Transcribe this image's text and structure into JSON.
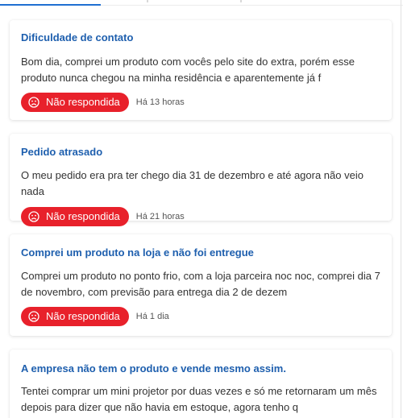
{
  "colors": {
    "title": "#1e5fae",
    "body_text": "#333333",
    "status_badge": "#e8212b",
    "tab_active": "#1f6fd1"
  },
  "complaints": [
    {
      "title": "Dificuldade de contato",
      "body": "Bom dia, comprei um produto com vocês pelo site do extra, porém esse produto nunca chegou na minha residência e aparentemente já f",
      "status": "Não respondida",
      "status_icon": "sad-face-icon",
      "time": "Há 13 horas"
    },
    {
      "title": "Pedido atrasado",
      "body": "O meu pedido era pra ter chego dia 31 de dezembro e até agora não veio nada",
      "status": "Não respondida",
      "status_icon": "sad-face-icon",
      "time": "Há 21 horas"
    },
    {
      "title": "Comprei um produto na loja e não foi entregue",
      "body": "Comprei um produto no ponto frio, com a loja parceira noc noc, comprei dia 7 de novembro, com previsão para entrega dia 2 de dezem",
      "status": "Não respondida",
      "status_icon": "sad-face-icon",
      "time": "Há 1 dia"
    },
    {
      "title": "A empresa não tem o produto e vende mesmo assim.",
      "body": "Tentei comprar um mini projetor por duas vezes e só me retornaram um mês depois para dizer que não havia em estoque, agora tenho q"
    }
  ]
}
